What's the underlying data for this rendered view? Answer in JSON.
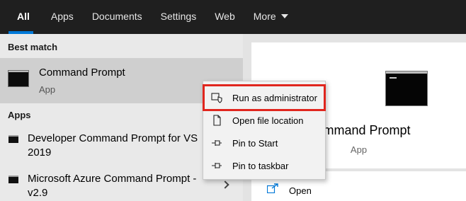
{
  "tabs": [
    {
      "label": "All",
      "active": true
    },
    {
      "label": "Apps"
    },
    {
      "label": "Documents"
    },
    {
      "label": "Settings"
    },
    {
      "label": "Web"
    },
    {
      "label": "More"
    }
  ],
  "best_match": {
    "header": "Best match",
    "title": "Command Prompt",
    "subtitle": "App",
    "icon": "command-prompt-icon"
  },
  "apps_section": {
    "header": "Apps",
    "items": [
      {
        "label_line1": "Developer Command Prompt for VS",
        "label_line2": "2019",
        "icon": "console-icon"
      },
      {
        "label_line1": "Microsoft Azure Command Prompt -",
        "label_line2": "v2.9",
        "icon": "console-icon"
      }
    ]
  },
  "preview": {
    "title": "Command Prompt",
    "subtitle": "App",
    "open_label": "Open",
    "open_icon": "open-external-icon"
  },
  "context_menu": {
    "items": [
      {
        "label": "Run as administrator",
        "icon": "shield-icon",
        "highlighted": true
      },
      {
        "label": "Open file location",
        "icon": "file-location-icon"
      },
      {
        "label": "Pin to Start",
        "icon": "pin-icon"
      },
      {
        "label": "Pin to taskbar",
        "icon": "pin-icon"
      }
    ]
  },
  "colors": {
    "topbar": "#1f1f1f",
    "accent": "#0078d7",
    "highlight_border": "#e0261e",
    "best_match_bg": "#cfcfcf"
  }
}
